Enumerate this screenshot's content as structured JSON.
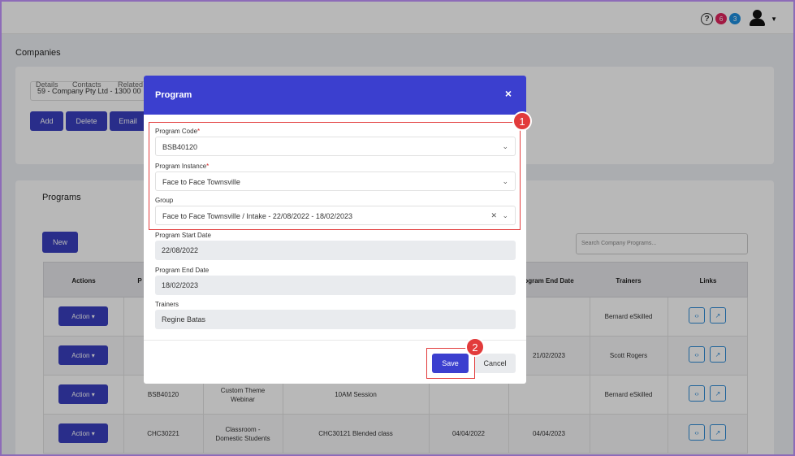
{
  "header": {
    "help_icon": "?",
    "badge_red": "6",
    "badge_blue": "3",
    "colors": {
      "red": "#e0245e",
      "blue": "#1e8fe0"
    }
  },
  "page": {
    "title": "Companies"
  },
  "company": {
    "selected": "59 - Company Pty Ltd - 1300 00",
    "buttons": {
      "add": "Add",
      "delete": "Delete",
      "email": "Email"
    },
    "tabs": [
      "Details",
      "Contacts",
      "Related"
    ]
  },
  "programs": {
    "title": "Programs",
    "new_label": "New",
    "search_placeholder": "Search Company Programs...",
    "columns": {
      "actions": "Actions",
      "program_prefix": "P",
      "end_date": "ogram End Date",
      "trainers": "Trainers",
      "links": "Links"
    },
    "rows": [
      {
        "action": "Action",
        "code": "",
        "type": "",
        "group": "",
        "start": "",
        "end": "",
        "trainer": "Bernard eSkilled"
      },
      {
        "action": "Action",
        "code": "",
        "type": "",
        "group": "",
        "start": "",
        "end": "21/02/2023",
        "trainer": "Scott Rogers"
      },
      {
        "action": "Action",
        "code": "BSB40120",
        "type": "Custom Theme Webinar",
        "group": "10AM Session",
        "start": "",
        "end": "",
        "trainer": "Bernard eSkilled"
      },
      {
        "action": "Action",
        "code": "CHC30221",
        "type": "Classroom - Domestic Students",
        "group": "CHC30121 Blended class",
        "start": "04/04/2022",
        "end": "04/04/2023",
        "trainer": ""
      }
    ]
  },
  "modal": {
    "title": "Program",
    "close": "×",
    "program_code_label": "Program Code",
    "program_code_value": "BSB40120",
    "program_instance_label": "Program Instance",
    "program_instance_value": "Face to Face Townsville",
    "group_label": "Group",
    "group_value": "Face to Face Townsville / Intake - 22/08/2022 - 18/02/2023",
    "start_label": "Program Start Date",
    "start_value": "22/08/2022",
    "end_label": "Program End Date",
    "end_value": "18/02/2023",
    "trainers_label": "Trainers",
    "trainers_value": "Regine Batas",
    "save": "Save",
    "cancel": "Cancel",
    "required_mark": "*",
    "accent": "#3b3fcf"
  },
  "annotations": {
    "marker1": "1",
    "marker2": "2",
    "color": "#e23b3b"
  }
}
